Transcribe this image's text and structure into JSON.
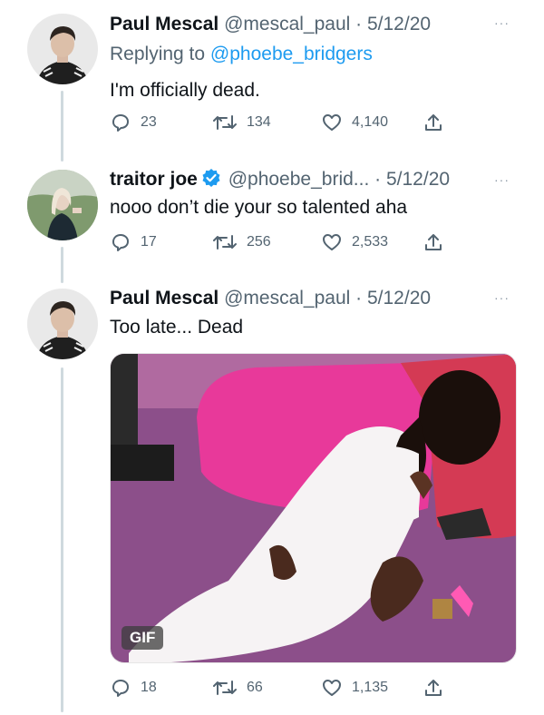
{
  "tweets": [
    {
      "author_name": "Paul Mescal",
      "handle": "@mescal_paul",
      "separator": "·",
      "date": "5/12/20",
      "reply_label": "Replying to",
      "reply_mention": "@phoebe_bridgers",
      "text": "I'm officially dead.",
      "replies": "23",
      "retweets": "134",
      "likes": "4,140",
      "more": "···"
    },
    {
      "author_name": "traitor joe",
      "handle": "@phoebe_brid...",
      "separator": "·",
      "date": "5/12/20",
      "verified": true,
      "text": "nooo don’t die your so talented aha",
      "replies": "17",
      "retweets": "256",
      "likes": "2,533",
      "more": "···"
    },
    {
      "author_name": "Paul Mescal",
      "handle": "@mescal_paul",
      "separator": "·",
      "date": "5/12/20",
      "text": "Too late... Dead",
      "media_badge": "GIF",
      "replies": "18",
      "retweets": "66",
      "likes": "1,135",
      "more": "···"
    }
  ],
  "colors": {
    "text": "#0f1419",
    "secondary": "#536471",
    "link": "#1d9bf0",
    "thread_line": "#cfd9de",
    "verified": "#1d9bf0"
  },
  "icons": [
    "reply-icon",
    "retweet-icon",
    "like-icon",
    "share-icon",
    "more-icon",
    "verified-badge-icon"
  ]
}
